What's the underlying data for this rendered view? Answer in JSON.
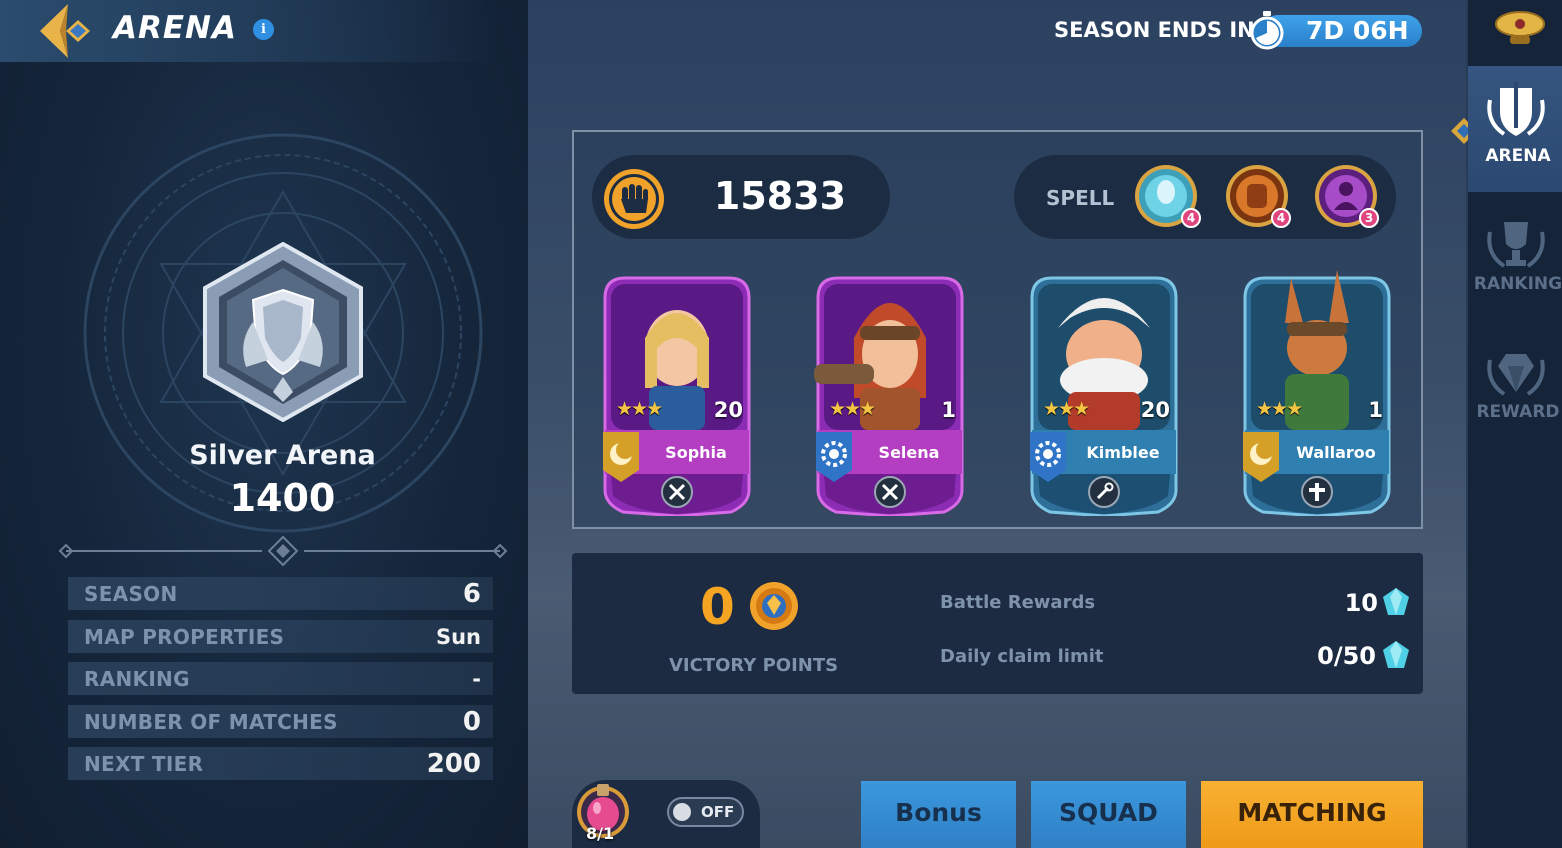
{
  "header": {
    "title": "ARENA",
    "info_label": "i"
  },
  "arena": {
    "name": "Silver Arena",
    "score": "1400"
  },
  "stats": [
    {
      "label": "SEASON",
      "value": "6"
    },
    {
      "label": "MAP PROPERTIES",
      "value": "Sun"
    },
    {
      "label": "RANKING",
      "value": "-"
    },
    {
      "label": "NUMBER OF MATCHES",
      "value": "0"
    },
    {
      "label": "NEXT TIER",
      "value": "200"
    }
  ],
  "season": {
    "label": "SEASON ENDS IN",
    "remaining": "7D 06H"
  },
  "team": {
    "power": "15833",
    "spell_label": "SPELL",
    "spells": [
      {
        "icon": "ice-spirit-spell-icon",
        "level": "4",
        "color": "#6fd3e8"
      },
      {
        "icon": "fire-golem-spell-icon",
        "level": "4",
        "color": "#d9782b"
      },
      {
        "icon": "shadow-spell-icon",
        "level": "3",
        "color": "#a64cc9"
      }
    ],
    "heroes": [
      {
        "name": "Sophia",
        "level": "20",
        "stars": "★★★",
        "class_icon": "moon-class-icon",
        "role_icon": "swords-role-icon",
        "rarity": "epic"
      },
      {
        "name": "Selena",
        "level": "1",
        "stars": "★★★",
        "class_icon": "gear-class-icon",
        "role_icon": "swords-role-icon",
        "rarity": "epic"
      },
      {
        "name": "Kimblee",
        "level": "20",
        "stars": "★★★",
        "class_icon": "gear-class-icon",
        "role_icon": "wrench-role-icon",
        "rarity": "rare"
      },
      {
        "name": "Wallaroo",
        "level": "1",
        "stars": "★★★",
        "class_icon": "moon-class-icon",
        "role_icon": "cross-role-icon",
        "rarity": "rare"
      }
    ]
  },
  "rewards": {
    "victory_points": "0",
    "victory_label": "VICTORY POINTS",
    "battle_rewards_label": "Battle Rewards",
    "battle_rewards_value": "10",
    "daily_limit_label": "Daily claim limit",
    "daily_limit_value": "0/50"
  },
  "potion": {
    "count": "8/1",
    "toggle": "OFF"
  },
  "buttons": {
    "bonus": "Bonus",
    "squad": "SQUAD",
    "matching": "MATCHING"
  },
  "nav": {
    "items": [
      {
        "label": "ARENA",
        "icon": "arena-icon",
        "active": true
      },
      {
        "label": "RANKING",
        "icon": "trophy-icon",
        "active": false
      },
      {
        "label": "REWARD",
        "icon": "diamond-icon",
        "active": false
      }
    ]
  },
  "colors": {
    "accent_orange": "#f5a522",
    "accent_blue": "#2f80c5",
    "epic": "#a33bc7",
    "rare": "#3a8fc2"
  }
}
